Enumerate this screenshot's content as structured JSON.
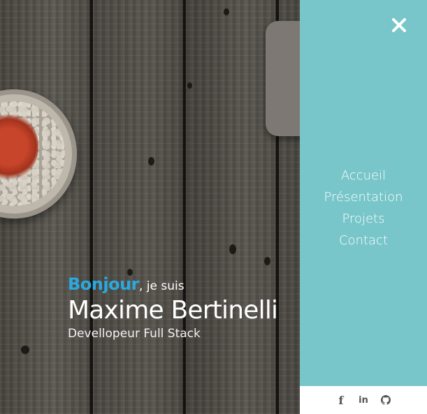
{
  "hero": {
    "greeting_highlight": "Bonjour",
    "greeting_rest": ", je suis",
    "name": "Maxime Bertinelli",
    "role": "Devellopeur Full Stack",
    "accent_color": "#2aa9e0"
  },
  "menu": {
    "background_color": "#78c6ca",
    "close_icon": "close-icon",
    "items": [
      {
        "label": "Accueil"
      },
      {
        "label": "Présentation"
      },
      {
        "label": "Projets"
      },
      {
        "label": "Contact"
      }
    ]
  },
  "social": {
    "icons": [
      "facebook-icon",
      "linkedin-icon",
      "github-icon"
    ],
    "facebook_glyph": "f",
    "linkedin_glyph": "in"
  }
}
